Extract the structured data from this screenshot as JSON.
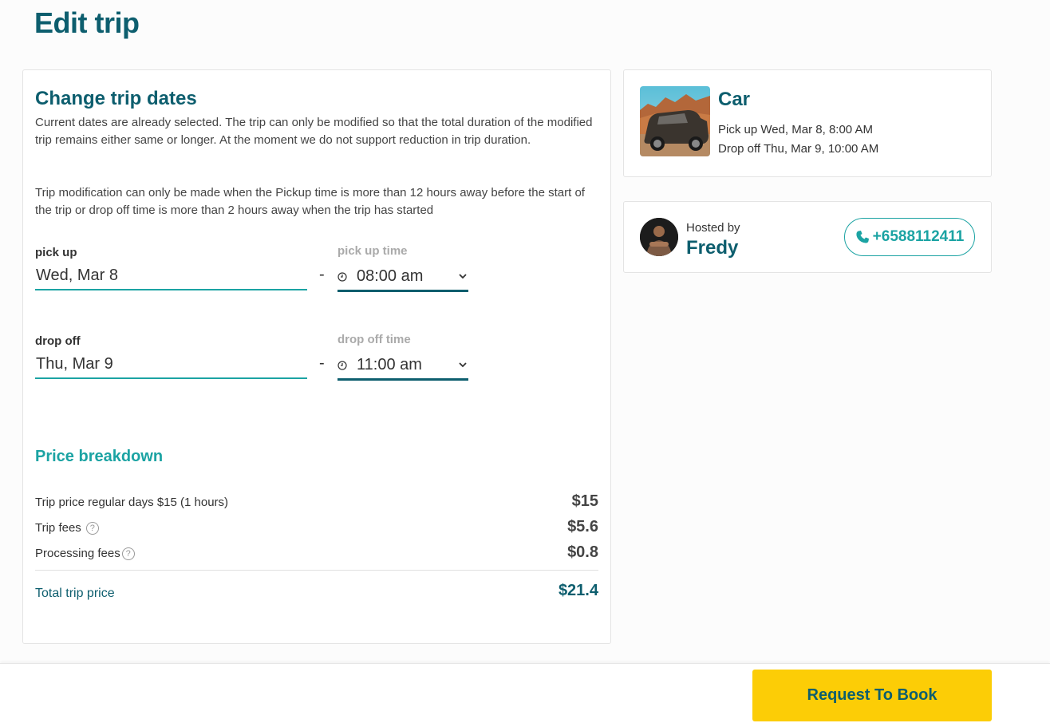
{
  "page": {
    "title": "Edit trip"
  },
  "change_dates": {
    "title": "Change trip dates",
    "description_1": "Current dates are already selected. The trip can only be modified so that the total duration of the modified trip remains either same or longer. At the moment we do not support reduction in trip duration.",
    "description_2": "Trip modification can only be made when the Pickup time is more than 12 hours away before the start of the trip or drop off time is more than 2 hours away when the trip has started",
    "pickup": {
      "date_label": "pick up",
      "date_value": "Wed, Mar 8",
      "separator": "-",
      "time_label": "pick up time",
      "time_value": "08:00 am"
    },
    "dropoff": {
      "date_label": "drop off",
      "date_value": "Thu, Mar 9",
      "separator": "-",
      "time_label": "drop off time",
      "time_value": "11:00 am"
    }
  },
  "price": {
    "title": "Price breakdown",
    "rows": [
      {
        "label": "Trip price regular days $15 (1 hours)",
        "value": "$15"
      },
      {
        "label": "Trip fees",
        "value": "$5.6"
      },
      {
        "label": "Processing fees",
        "value": "$0.8"
      }
    ],
    "total_label": "Total trip price",
    "total_value": "$21.4",
    "help_icon": "?"
  },
  "car": {
    "name": "Car",
    "pickup_line": "Pick up Wed, Mar 8, 8:00 AM",
    "dropoff_line": "Drop off Thu, Mar 9, 10:00 AM"
  },
  "host": {
    "hosted_by_label": "Hosted by",
    "name": "Fredy",
    "phone": "+6588112411"
  },
  "footer": {
    "book_label": "Request To Book"
  },
  "colors": {
    "primary": "#0d5e6e",
    "teal": "#1ba3a3",
    "accent": "#fccd06"
  }
}
